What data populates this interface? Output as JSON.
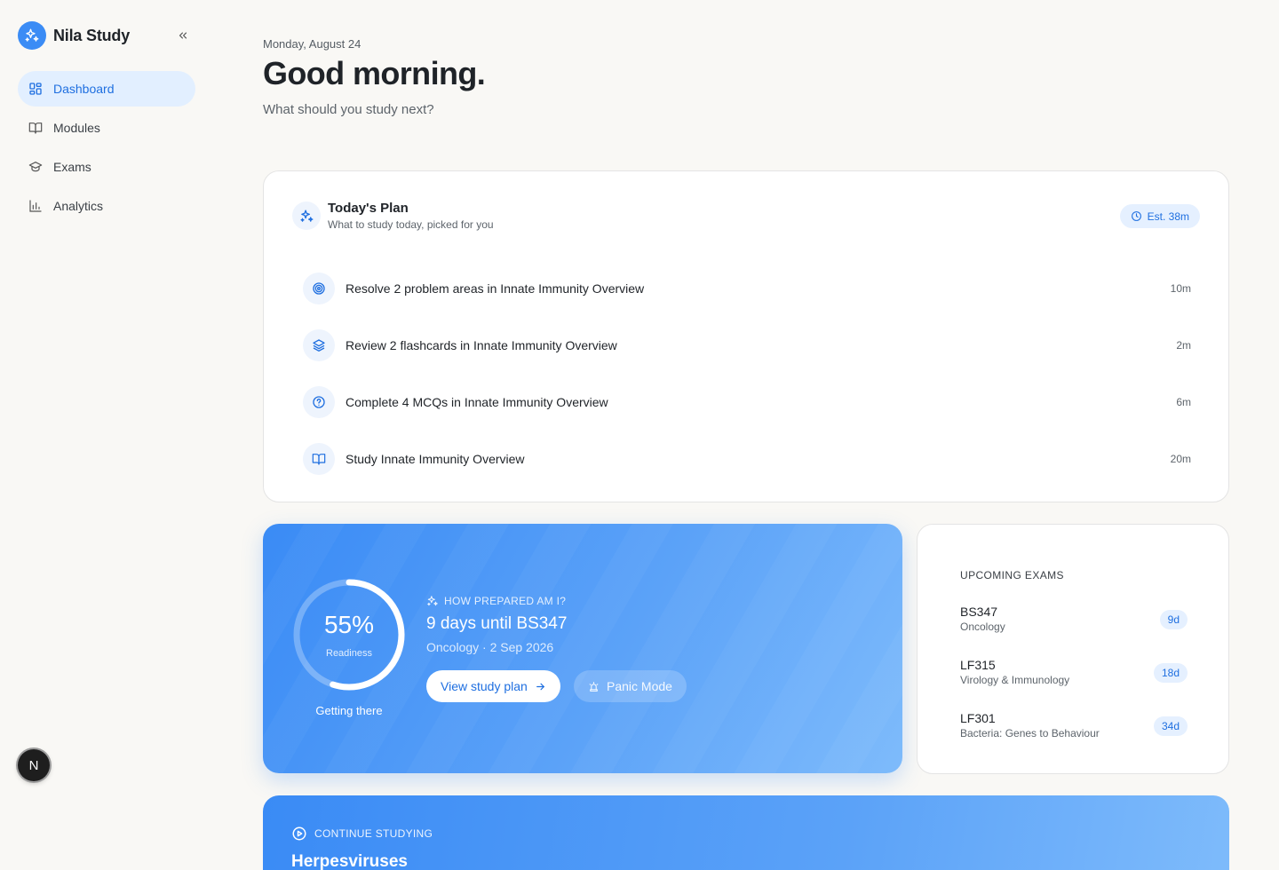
{
  "sidebar": {
    "brand": "Nila Study",
    "items": [
      {
        "label": "Dashboard",
        "icon": "grid-icon",
        "active": true
      },
      {
        "label": "Modules",
        "icon": "book-icon"
      },
      {
        "label": "Exams",
        "icon": "graduation-cap-icon"
      },
      {
        "label": "Analytics",
        "icon": "bar-chart-icon"
      }
    ],
    "avatar_initial": "N"
  },
  "header": {
    "date": "Monday, August 24",
    "greeting": "Good morning.",
    "subtitle": "What should you study next?"
  },
  "plan": {
    "title": "Today's Plan",
    "subtitle": "What to study today, picked for you",
    "estimate": "Est. 38m",
    "tasks": [
      {
        "label": "Resolve 2 problem areas in Innate Immunity Overview",
        "time": "10m",
        "icon": "target-icon"
      },
      {
        "label": "Review 2 flashcards in Innate Immunity Overview",
        "time": "2m",
        "icon": "layers-icon"
      },
      {
        "label": "Complete 4 MCQs in Innate Immunity Overview",
        "time": "6m",
        "icon": "question-icon"
      },
      {
        "label": "Study Innate Immunity Overview",
        "time": "20m",
        "icon": "book-icon"
      }
    ]
  },
  "readiness": {
    "percent_value": 55,
    "percent_label": "55%",
    "caption": "Readiness",
    "status": "Getting there",
    "label": "HOW PREPARED AM I?",
    "title": "9 days until BS347",
    "subtitle": "Oncology · 2 Sep 2026",
    "primary_button": "View study plan",
    "secondary_button": "Panic Mode"
  },
  "exams": {
    "title": "UPCOMING EXAMS",
    "items": [
      {
        "code": "BS347",
        "name": "Oncology",
        "days": "9d"
      },
      {
        "code": "LF315",
        "name": "Virology & Immunology",
        "days": "18d"
      },
      {
        "code": "LF301",
        "name": "Bacteria: Genes to Behaviour",
        "days": "34d"
      }
    ]
  },
  "continue": {
    "label": "CONTINUE STUDYING",
    "title": "Herpesviruses"
  },
  "colors": {
    "accent": "#3b8cf5",
    "accent_text": "#1f6fe0",
    "badge_bg": "#e5f0ff",
    "background": "#f9f8f5"
  }
}
